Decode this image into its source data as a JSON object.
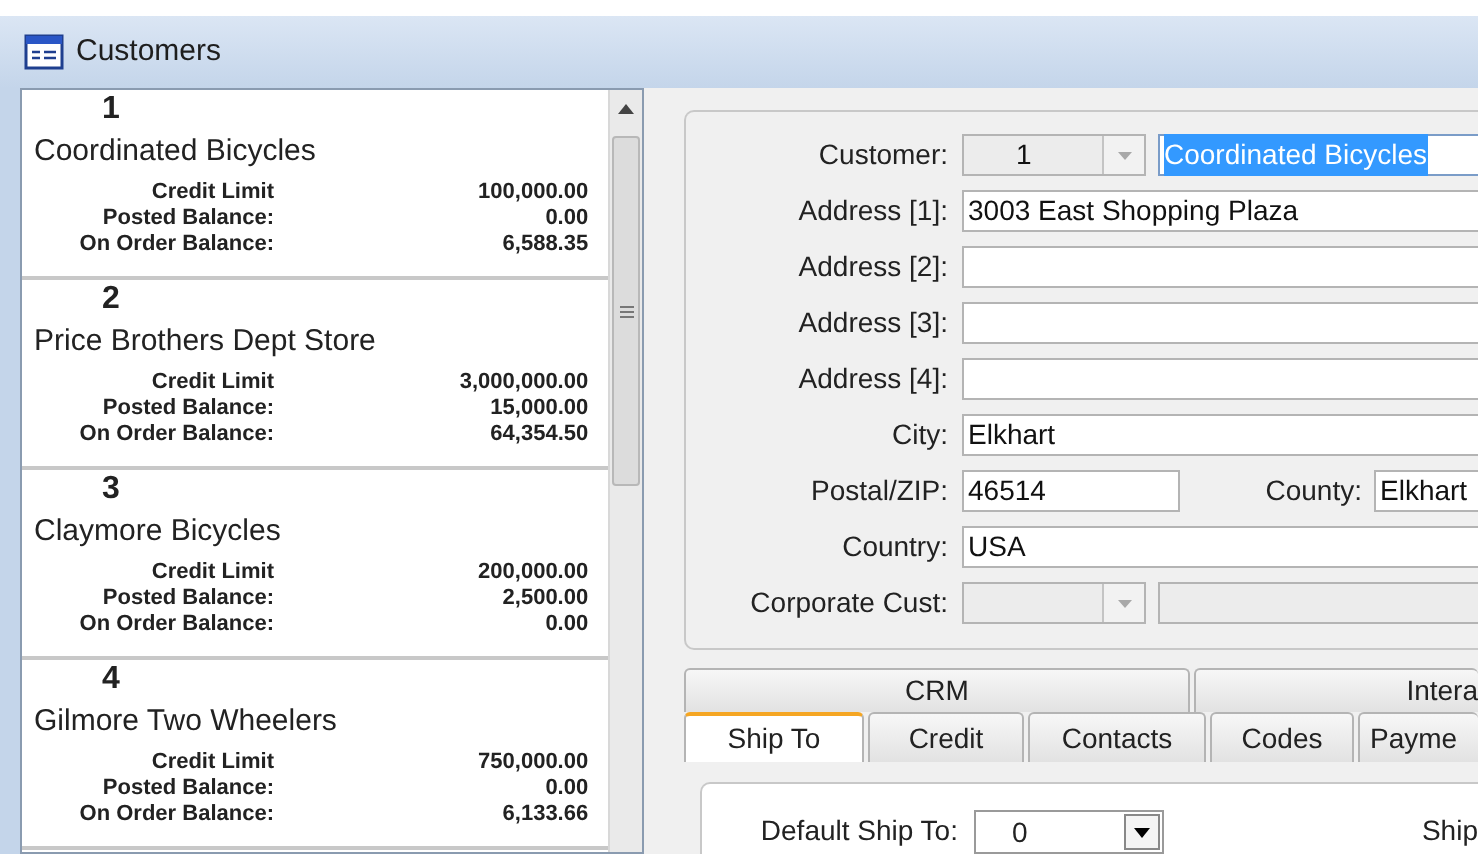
{
  "window": {
    "title": "Customers"
  },
  "customers": [
    {
      "number": "1",
      "name": "Coordinated Bicycles",
      "credit_limit_label": "Credit Limit",
      "credit_limit": "100,000.00",
      "posted_label": "Posted Balance:",
      "posted": "0.00",
      "on_order_label": "On Order Balance:",
      "on_order": "6,588.35"
    },
    {
      "number": "2",
      "name": "Price Brothers Dept Store",
      "credit_limit_label": "Credit Limit",
      "credit_limit": "3,000,000.00",
      "posted_label": "Posted Balance:",
      "posted": "15,000.00",
      "on_order_label": "On Order Balance:",
      "on_order": "64,354.50"
    },
    {
      "number": "3",
      "name": "Claymore Bicycles",
      "credit_limit_label": "Credit Limit",
      "credit_limit": "200,000.00",
      "posted_label": "Posted Balance:",
      "posted": "2,500.00",
      "on_order_label": "On Order Balance:",
      "on_order": "0.00"
    },
    {
      "number": "4",
      "name": "Gilmore Two Wheelers",
      "credit_limit_label": "Credit Limit",
      "credit_limit": "750,000.00",
      "posted_label": "Posted Balance:",
      "posted": "0.00",
      "on_order_label": "On Order Balance:",
      "on_order": "6,133.66"
    }
  ],
  "form": [
    {
      "kind": "combo_text",
      "label": "Customer:",
      "number": "1",
      "value": "Coordinated Bicycles",
      "highlighted": true,
      "disabled": true
    },
    {
      "kind": "text",
      "label": "Address [1]:",
      "value": "3003 East Shopping Plaza"
    },
    {
      "kind": "text",
      "label": "Address [2]:"
    },
    {
      "kind": "text",
      "label": "Address [3]:"
    },
    {
      "kind": "text",
      "label": "Address [4]:"
    },
    {
      "kind": "text",
      "label": "City:",
      "value": "Elkhart"
    },
    {
      "kind": "zip_county",
      "label": "Postal/ZIP:",
      "value": "46514",
      "second_label": "County:",
      "second_value": "Elkhart"
    },
    {
      "kind": "text",
      "label": "Country:",
      "value": "USA"
    },
    {
      "kind": "combo_text",
      "label": "Corporate Cust:",
      "disabled": true
    }
  ],
  "tab_rows": [
    [
      {
        "label": "CRM",
        "selected": false
      },
      {
        "label": "Intera",
        "selected": false
      }
    ],
    [
      {
        "label": "Ship To",
        "selected": true
      },
      {
        "label": "Credit",
        "selected": false
      },
      {
        "label": "Contacts",
        "selected": false
      },
      {
        "label": "Codes",
        "selected": false
      },
      {
        "label": "Payme",
        "selected": false
      }
    ]
  ],
  "ship_to": {
    "label": "Default Ship To:",
    "value": "0",
    "next_label": "Ship"
  }
}
